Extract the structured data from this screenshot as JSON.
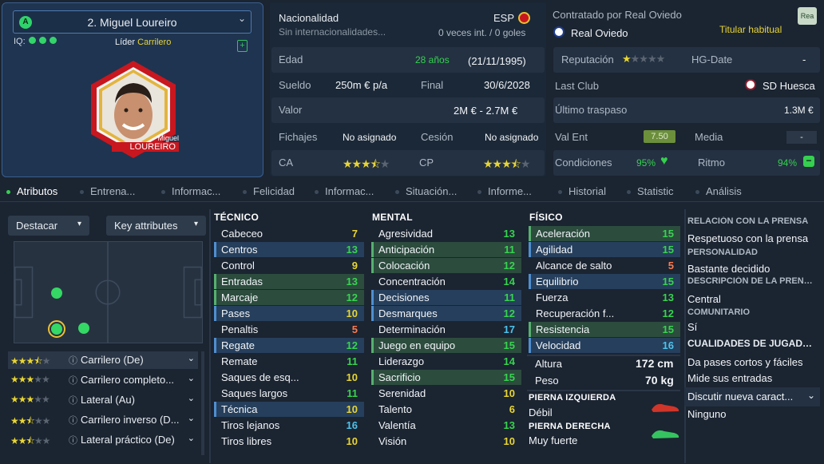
{
  "player": {
    "number_name": "2. Miguel Loureiro",
    "badge": "A",
    "iq_label": "IQ:",
    "role_a": "Líder",
    "role_b": "Carrilero",
    "caption_first": "Miguel",
    "caption_last": "LOUREIRO"
  },
  "info": {
    "nationality_label": "Nacionalidad",
    "nationality_code": "ESP",
    "caps_label": "Sin internacionalidades...",
    "caps_val": "0 veces int. / 0 goles",
    "signed_by": "Contratado por Real Oviedo",
    "rea": "Rea",
    "club": "Real Oviedo",
    "squad_status": "Titular habitual",
    "age_label": "Edad",
    "age": "28 años",
    "dob": "(21/11/1995)",
    "rep_label": "Reputación",
    "hgdate_label": "HG-Date",
    "hgdate": "-",
    "wage_label": "Sueldo",
    "wage": "250m € p/a",
    "end_label": "Final",
    "end": "30/6/2028",
    "lastclub_label": "Last Club",
    "lastclub": "SD Huesca",
    "value_label": "Valor",
    "value": "2M € - 2.7M €",
    "transfer_label": "Último traspaso",
    "transfer": "1.3M €",
    "fichajes_label": "Fichajes",
    "fichajes": "No asignado",
    "cesion_label": "Cesión",
    "cesion": "No asignado",
    "valent_label": "Val Ent",
    "valent": "7.50",
    "media_label": "Media",
    "media": "-",
    "ca_label": "CA",
    "cp_label": "CP",
    "cond_label": "Condiciones",
    "cond": "95%",
    "ritmo_label": "Ritmo",
    "ritmo": "94%"
  },
  "tabs": [
    "Atributos",
    "Entrena...",
    "Informac...",
    "Felicidad",
    "Informac...",
    "Situación...",
    "Informe...",
    "Historial",
    "Statistic",
    "Análisis"
  ],
  "left": {
    "highlight_label": "Destacar",
    "key_label": "Key attributes",
    "roles": [
      {
        "name": "Carrilero (De)",
        "stars": 3.5
      },
      {
        "name": "Carrilero completo...",
        "stars": 3
      },
      {
        "name": "Lateral (Au)",
        "stars": 3
      },
      {
        "name": "Carrilero inverso (D...",
        "stars": 2.5
      },
      {
        "name": "Lateral práctico (De)",
        "stars": 2.5
      }
    ]
  },
  "tecnico": {
    "title": "TÉCNICO",
    "items": [
      {
        "name": "Cabeceo",
        "v": 7,
        "hl": ""
      },
      {
        "name": "Centros",
        "v": 13,
        "hl": "b"
      },
      {
        "name": "Control",
        "v": 9,
        "hl": ""
      },
      {
        "name": "Entradas",
        "v": 13,
        "hl": "g"
      },
      {
        "name": "Marcaje",
        "v": 12,
        "hl": "g"
      },
      {
        "name": "Pases",
        "v": 10,
        "hl": "b"
      },
      {
        "name": "Penaltis",
        "v": 5,
        "hl": ""
      },
      {
        "name": "Regate",
        "v": 12,
        "hl": "b"
      },
      {
        "name": "Remate",
        "v": 11,
        "hl": ""
      },
      {
        "name": "Saques de esq...",
        "v": 10,
        "hl": ""
      },
      {
        "name": "Saques largos",
        "v": 11,
        "hl": ""
      },
      {
        "name": "Técnica",
        "v": 10,
        "hl": "b"
      },
      {
        "name": "Tiros lejanos",
        "v": 16,
        "hl": ""
      },
      {
        "name": "Tiros libres",
        "v": 10,
        "hl": ""
      }
    ]
  },
  "mental": {
    "title": "MENTAL",
    "items": [
      {
        "name": "Agresividad",
        "v": 13,
        "hl": ""
      },
      {
        "name": "Anticipación",
        "v": 11,
        "hl": "g"
      },
      {
        "name": "Colocación",
        "v": 12,
        "hl": "g"
      },
      {
        "name": "Concentración",
        "v": 14,
        "hl": ""
      },
      {
        "name": "Decisiones",
        "v": 11,
        "hl": "b"
      },
      {
        "name": "Desmarques",
        "v": 12,
        "hl": "b"
      },
      {
        "name": "Determinación",
        "v": 17,
        "hl": ""
      },
      {
        "name": "Juego en equipo",
        "v": 15,
        "hl": "g"
      },
      {
        "name": "Liderazgo",
        "v": 14,
        "hl": ""
      },
      {
        "name": "Sacrificio",
        "v": 15,
        "hl": "g"
      },
      {
        "name": "Serenidad",
        "v": 10,
        "hl": ""
      },
      {
        "name": "Talento",
        "v": 6,
        "hl": ""
      },
      {
        "name": "Valentía",
        "v": 13,
        "hl": ""
      },
      {
        "name": "Visión",
        "v": 10,
        "hl": ""
      }
    ]
  },
  "fisico": {
    "title": "FÍSICO",
    "items": [
      {
        "name": "Aceleración",
        "v": 15,
        "hl": "g"
      },
      {
        "name": "Agilidad",
        "v": 15,
        "hl": "b"
      },
      {
        "name": "Alcance de salto",
        "v": 5,
        "hl": ""
      },
      {
        "name": "Equilibrio",
        "v": 15,
        "hl": "b"
      },
      {
        "name": "Fuerza",
        "v": 13,
        "hl": ""
      },
      {
        "name": "Recuperación f...",
        "v": 12,
        "hl": ""
      },
      {
        "name": "Resistencia",
        "v": 15,
        "hl": "g"
      },
      {
        "name": "Velocidad",
        "v": 16,
        "hl": "b"
      }
    ],
    "height_label": "Altura",
    "height": "172 cm",
    "weight_label": "Peso",
    "weight": "70 kg",
    "left_foot_label": "PIERNA IZQUIERDA",
    "left_foot": "Débil",
    "right_foot_label": "PIERNA DERECHA",
    "right_foot": "Muy fuerte"
  },
  "right": {
    "rel_title": "RELACIÓN CON LA PRENSA",
    "rel": "Respetuoso con la prensa",
    "pers_title": "PERSONALIDAD",
    "pers": "Bastante decidido",
    "desc_title": "DESCRIPCIÓN DE LA PRENSA",
    "desc": "Central",
    "com_title": "COMUNITARIO",
    "com": "Sí",
    "qual_title": "CUALIDADES DE JUGADOR",
    "qual1": "Da pases cortos y fáciles",
    "qual2": "Mide sus entradas",
    "discuss": "Discutir nueva caract...",
    "none": "Ninguno"
  },
  "colors": {
    "green": "#35d04f",
    "yellow": "#e8d533",
    "blue": "#4cc3ec",
    "orange": "#ff7a4d"
  }
}
